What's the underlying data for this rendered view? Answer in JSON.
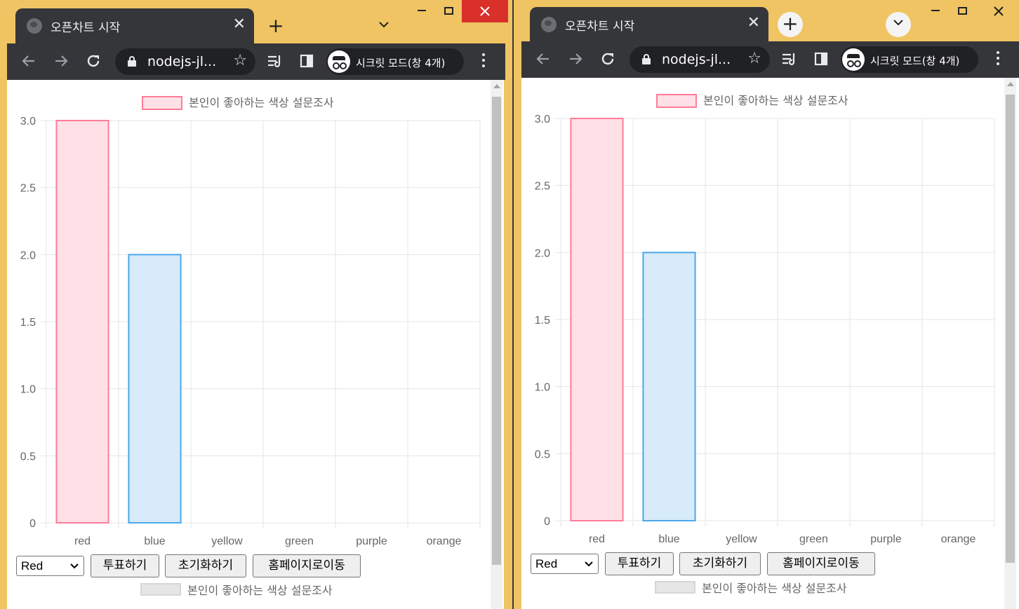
{
  "windows": [
    {
      "id": "left",
      "tab": {
        "title": "오픈차트 시작",
        "close": "✕"
      },
      "new_tab": "+",
      "toolbar": {
        "url": "nodejs-jl...",
        "incognito_label": "시크릿 모드(창 4개)"
      },
      "chart_data": {
        "type": "bar",
        "categories": [
          "red",
          "blue",
          "yellow",
          "green",
          "purple",
          "orange"
        ],
        "series": [
          {
            "name": "본인이 좋아하는 색상 설문조사",
            "values": [
              3,
              2,
              0,
              0,
              0,
              0
            ]
          }
        ],
        "yticks": [
          "0",
          "0.5",
          "1.0",
          "1.5",
          "2.0",
          "2.5",
          "3.0"
        ],
        "ylim": [
          0,
          3
        ],
        "legend_position": "top",
        "grid": true,
        "colors": {
          "fills": [
            "#ffe0e6",
            "#d7ebfa"
          ],
          "borders": [
            "#ff7c98",
            "#4ba8eb"
          ]
        }
      },
      "controls": {
        "select_value": "Red",
        "vote_button": "투표하기",
        "reset_button": "초기화하기",
        "home_button": "홈페이지로이동"
      },
      "second_chart_legend": "본인이 좋아하는 색상 설문조사"
    },
    {
      "id": "right",
      "tab": {
        "title": "오픈차트 시작",
        "close": "✕"
      },
      "new_tab": "+",
      "toolbar": {
        "url": "nodejs-jl...",
        "incognito_label": "시크릿 모드(창 4개)"
      },
      "chart_data": {
        "type": "bar",
        "categories": [
          "red",
          "blue",
          "yellow",
          "green",
          "purple",
          "orange"
        ],
        "series": [
          {
            "name": "본인이 좋아하는 색상 설문조사",
            "values": [
              3,
              2,
              0,
              0,
              0,
              0
            ]
          }
        ],
        "yticks": [
          "0",
          "0.5",
          "1.0",
          "1.5",
          "2.0",
          "2.5",
          "3.0"
        ],
        "ylim": [
          0,
          3
        ],
        "legend_position": "top",
        "grid": true,
        "colors": {
          "fills": [
            "#ffe0e6",
            "#d7ebfa"
          ],
          "borders": [
            "#ff7c98",
            "#4ba8eb"
          ]
        }
      },
      "controls": {
        "select_value": "Red",
        "vote_button": "투표하기",
        "reset_button": "초기화하기",
        "home_button": "홈페이지로이동"
      },
      "second_chart_legend": "본인이 좋아하는 색상 설문조사"
    }
  ]
}
